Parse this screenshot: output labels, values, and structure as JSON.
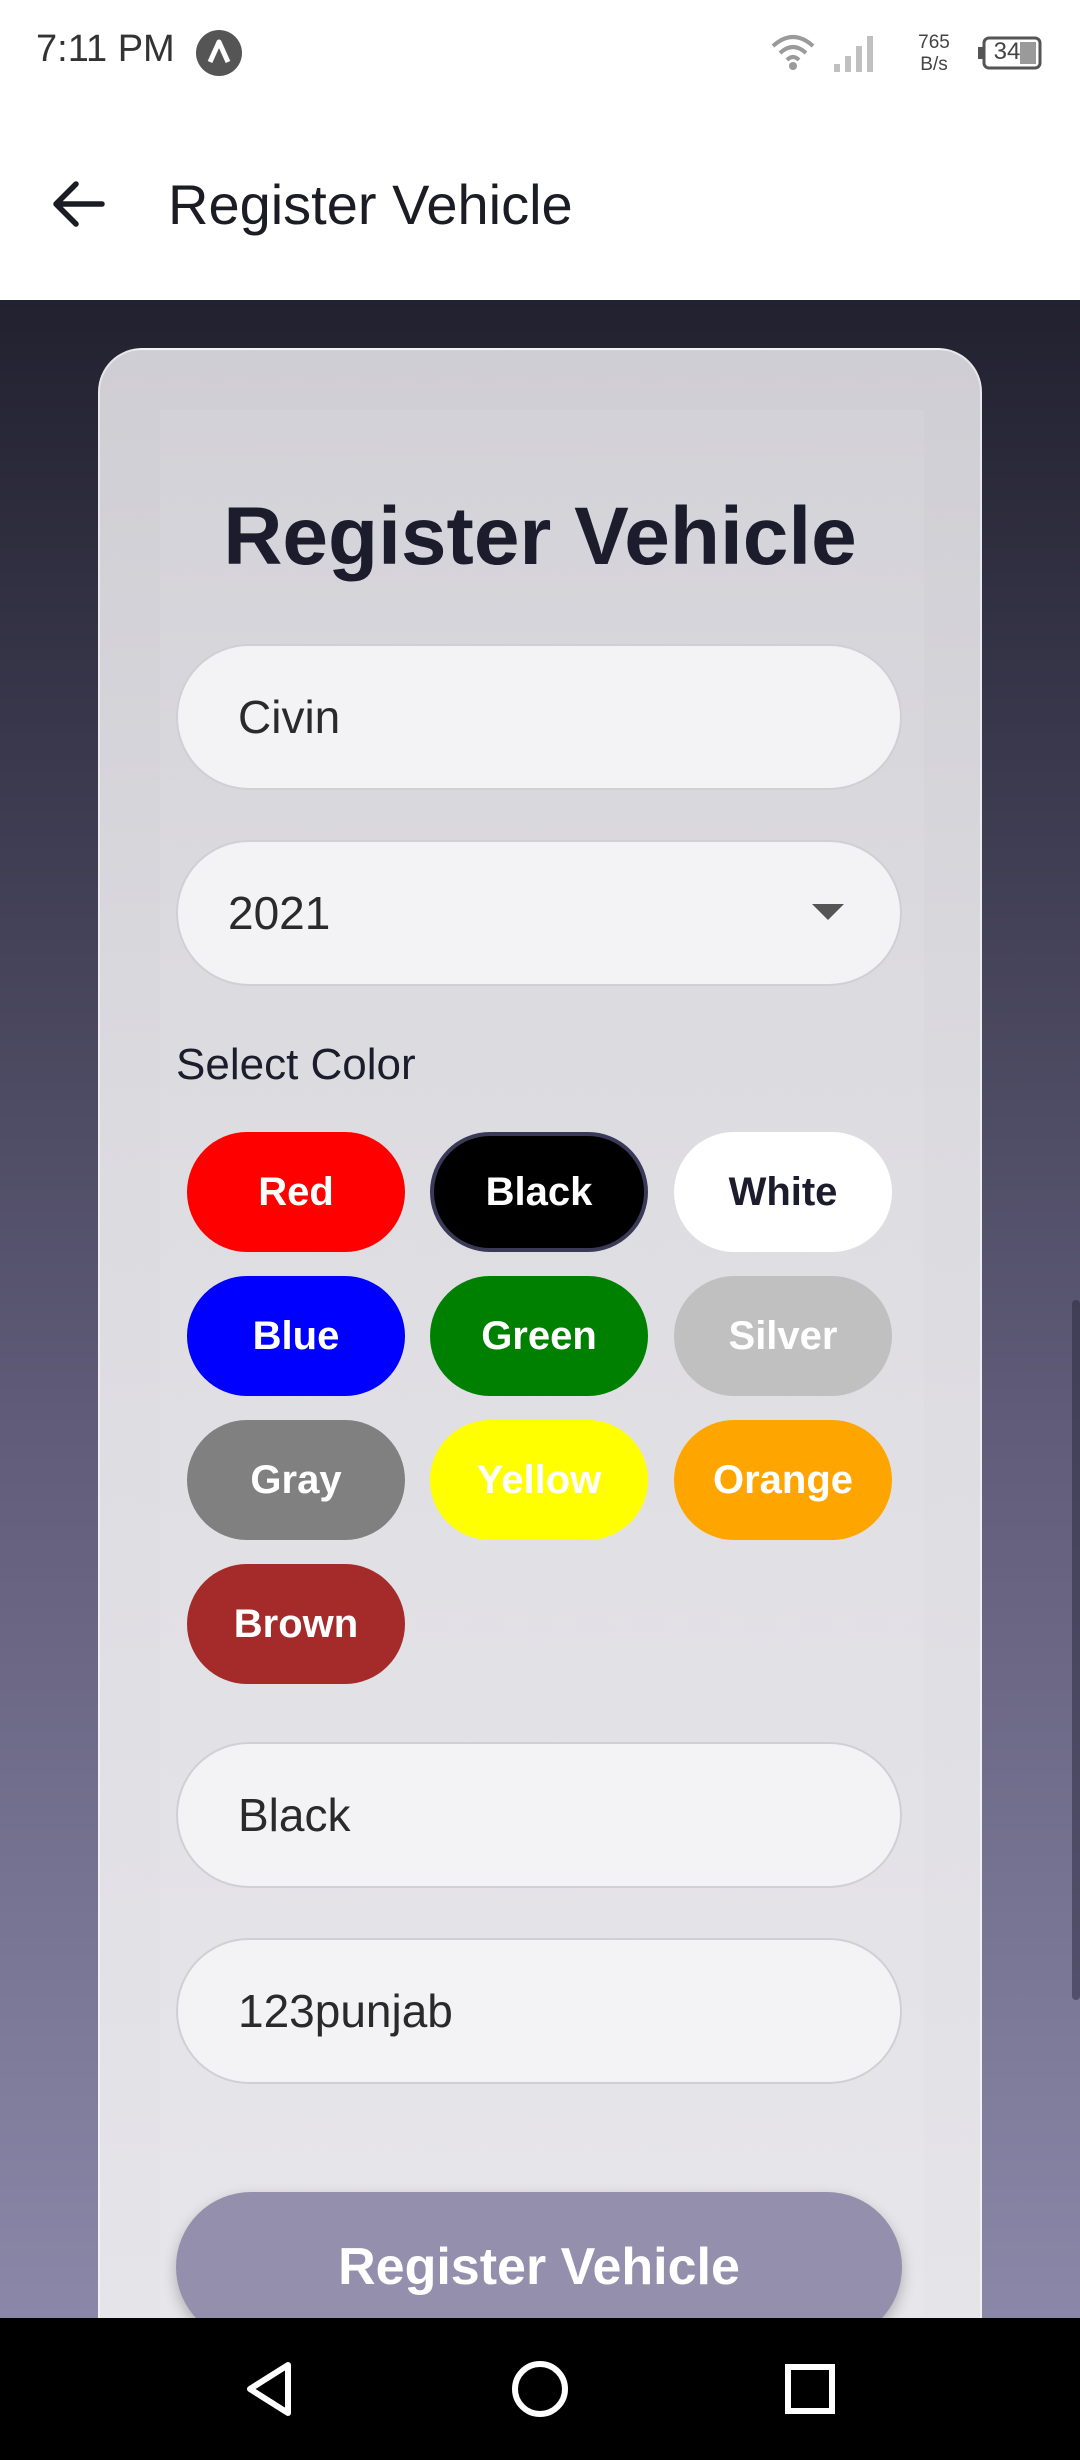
{
  "status_bar": {
    "time": "7:11 PM",
    "net_speed_value": "765",
    "net_speed_unit": "B/s",
    "battery": "34",
    "icons": [
      "app-notification-icon",
      "wifi-icon",
      "signal-icon",
      "battery-icon"
    ]
  },
  "app_bar": {
    "back_icon": "arrow-left-icon",
    "title": "Register Vehicle"
  },
  "form": {
    "title": "Register Vehicle",
    "model_value": "Civin",
    "year_value": "2021",
    "select_color_label": "Select Color",
    "colors": [
      {
        "label": "Red",
        "bg": "#ff0000",
        "text": "#ffffff"
      },
      {
        "label": "Black",
        "bg": "#000000",
        "text": "#ffffff",
        "selected": true
      },
      {
        "label": "White",
        "bg": "#ffffff",
        "text": "#1c1c2c"
      },
      {
        "label": "Blue",
        "bg": "#0000ff",
        "text": "#ffffff"
      },
      {
        "label": "Green",
        "bg": "#008000",
        "text": "#ffffff"
      },
      {
        "label": "Silver",
        "bg": "#c0c0c0",
        "text": "#ffffff"
      },
      {
        "label": "Gray",
        "bg": "#808080",
        "text": "#ffffff"
      },
      {
        "label": "Yellow",
        "bg": "#ffff00",
        "text": "#ffffff"
      },
      {
        "label": "Orange",
        "bg": "#ffa500",
        "text": "#ffffff"
      },
      {
        "label": "Brown",
        "bg": "#a52a2a",
        "text": "#ffffff"
      }
    ],
    "color_value": "Black",
    "plate_value": "123punjab",
    "submit_label": "Register Vehicle"
  },
  "nav_bar": {
    "icons": [
      "back-triangle-icon",
      "home-circle-icon",
      "recents-square-icon"
    ]
  }
}
